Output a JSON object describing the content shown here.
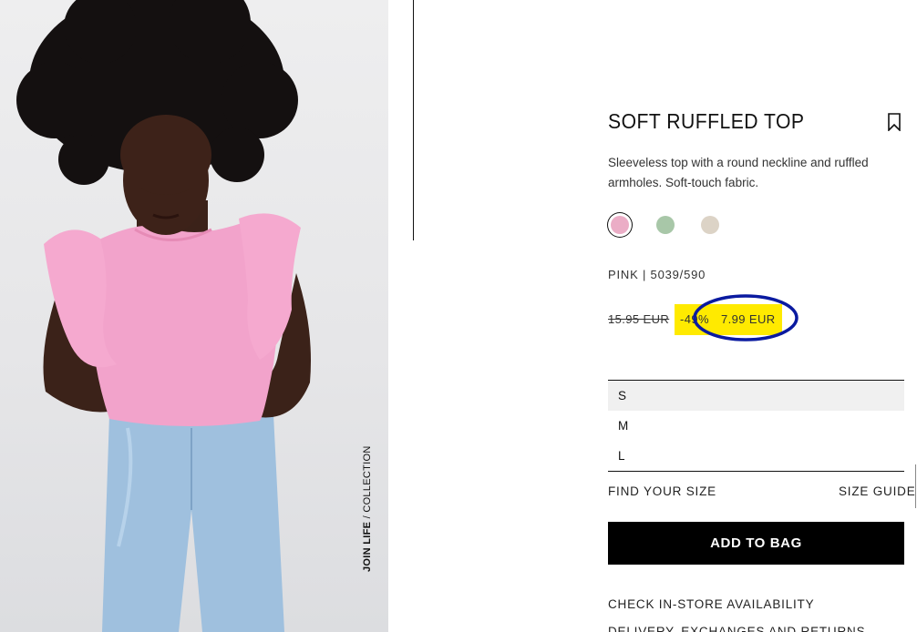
{
  "product": {
    "title": "SOFT RUFFLED TOP",
    "description": "Sleeveless top with a round neckline and ruffled armholes. Soft-touch fabric.",
    "color_reference": "PINK | 5039/590",
    "old_price": "15.95 EUR",
    "discount": "-49%",
    "price": "7.99 EUR",
    "swatches": [
      {
        "name": "pink",
        "color": "#ebadc6",
        "selected": true
      },
      {
        "name": "green",
        "color": "#a8c7a8",
        "selected": false
      },
      {
        "name": "beige",
        "color": "#dcd3c6",
        "selected": false
      }
    ]
  },
  "photo": {
    "caption_bold": "JOIN LIFE",
    "caption_rest": " / COLLECTION"
  },
  "sizes": {
    "options": [
      "S",
      "M",
      "L"
    ],
    "selected": "S"
  },
  "links": {
    "find_your_size": "FIND YOUR SIZE",
    "size_guide": "SIZE GUIDE",
    "check_store": "CHECK IN-STORE AVAILABILITY",
    "delivery": "DELIVERY, EXCHANGES AND RETURNS"
  },
  "buttons": {
    "add_to_bag": "ADD TO BAG"
  },
  "icons": {
    "bookmark": "bookmark-icon"
  },
  "colors": {
    "price_highlight": "#ffea00",
    "annotation_ring": "#0a1aa0",
    "button_bg": "#000000"
  }
}
